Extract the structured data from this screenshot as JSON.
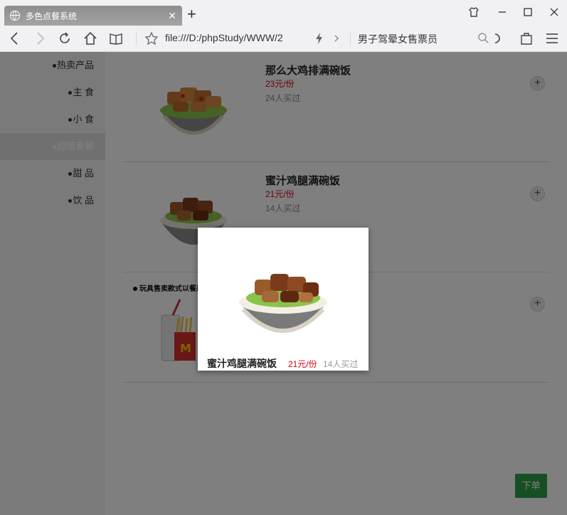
{
  "browser": {
    "tab_title": "多色点餐系统",
    "tab_close": "✕",
    "new_tab": "+",
    "address": "file:///D:/phpStudy/WWW/2",
    "search_suggestion": "男子驾晕女售票员"
  },
  "sidebar": {
    "categories": [
      {
        "label": "热卖产品"
      },
      {
        "label": "主 食"
      },
      {
        "label": "小 食"
      },
      {
        "label": "超值套餐"
      },
      {
        "label": "甜 品"
      },
      {
        "label": "饮 品"
      }
    ],
    "active_index": 3
  },
  "products": [
    {
      "name": "那么大鸡排满碗饭",
      "price": "23元/份",
      "sold": "24人买过",
      "add": "+"
    },
    {
      "name": "蜜汁鸡腿满碗饭",
      "price": "21元/份",
      "sold": "14人买过",
      "add": "+"
    },
    {
      "combo_label": "玩具售卖款式以餐厅",
      "add": "+"
    }
  ],
  "popup": {
    "name": "蜜汁鸡腿满碗饭",
    "price": "21元/份",
    "sold": "14人买过"
  },
  "order_button": "下单",
  "colors": {
    "price": "#d7000f",
    "order_button": "#2e9e4b",
    "active_category": "#e1e1e1"
  }
}
